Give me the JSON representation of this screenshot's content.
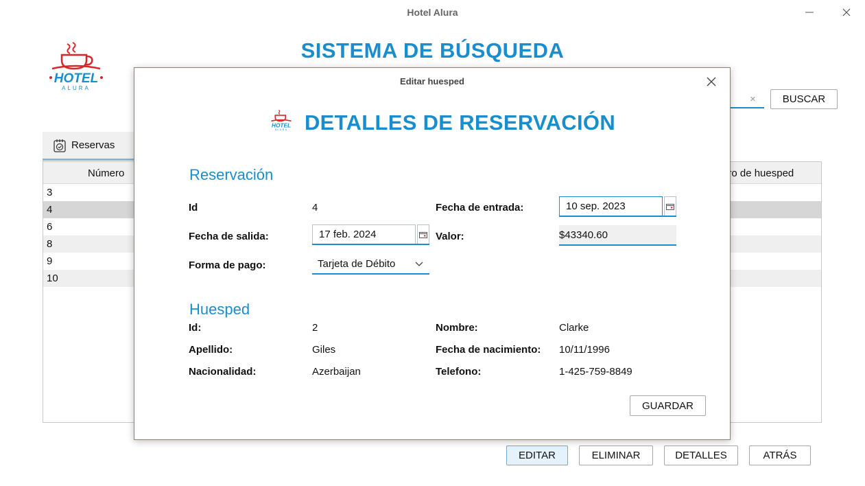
{
  "window": {
    "title": "Hotel Alura"
  },
  "logo": {
    "text_top": "HOTEL",
    "text_bottom": "ALURA"
  },
  "main_title": "SISTEMA DE BÚSQUEDA",
  "search": {
    "clear_symbol": "×",
    "button_label": "BUSCAR"
  },
  "tabs": [
    {
      "label": "Reservas",
      "icon": "calendar-check-icon"
    }
  ],
  "table": {
    "columns": [
      "Número",
      "ero de huesped"
    ],
    "rows": [
      "3",
      "4",
      "6",
      "8",
      "9",
      "10"
    ],
    "selected_row": 1
  },
  "actions": {
    "editar": "EDITAR",
    "eliminar": "ELIMINAR",
    "detalles": "DETALLES",
    "atras": "ATRÁS"
  },
  "dialog": {
    "title": "Editar huesped",
    "heading": "DETALLES DE RESERVACIÓN",
    "reservacion": {
      "section_title": "Reservación",
      "id_label": "Id",
      "id_value": "4",
      "fecha_entrada_label": "Fecha de entrada:",
      "fecha_entrada_value": "10 sep. 2023",
      "fecha_salida_label": "Fecha de salida:",
      "fecha_salida_value": "17 feb. 2024",
      "valor_label": "Valor:",
      "valor_value": "$43340.60",
      "forma_pago_label": "Forma de pago:",
      "forma_pago_value": "Tarjeta de Débito"
    },
    "huesped": {
      "section_title": "Huesped",
      "id_label": "Id:",
      "id_value": "2",
      "nombre_label": "Nombre:",
      "nombre_value": "Clarke",
      "apellido_label": "Apellido:",
      "apellido_value": "Giles",
      "fecha_nac_label": "Fecha de nacimiento:",
      "fecha_nac_value": "10/11/1996",
      "nacionalidad_label": "Nacionalidad:",
      "nacionalidad_value": "Azerbaijan",
      "telefono_label": "Telefono:",
      "telefono_value": "1-425-759-8849"
    },
    "save_label": "GUARDAR"
  },
  "colors": {
    "accent": "#1a8dcc",
    "logo_red": "#d9262b"
  }
}
